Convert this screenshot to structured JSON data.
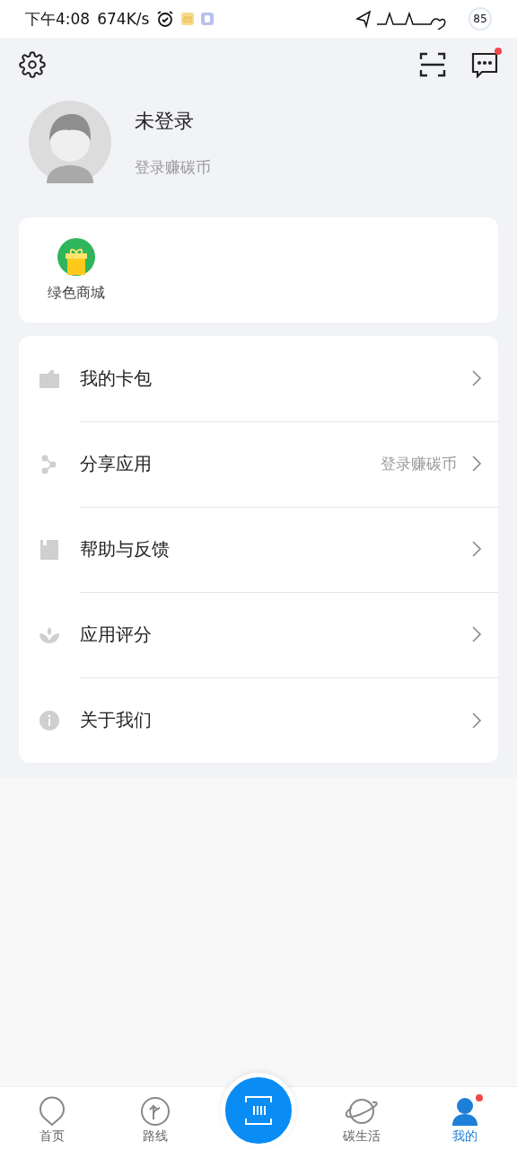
{
  "status_bar": {
    "time": "下午4:08",
    "speed": "674K/s",
    "battery": "85"
  },
  "header": {
    "message_badge": true
  },
  "profile": {
    "name": "未登录",
    "subtitle": "登录赚碳币"
  },
  "shortcuts": [
    {
      "label": "绿色商城"
    }
  ],
  "menu": [
    {
      "kind": "wallet",
      "label": "我的卡包"
    },
    {
      "kind": "share",
      "label": "分享应用",
      "note": "登录赚碳币"
    },
    {
      "kind": "book",
      "label": "帮助与反馈"
    },
    {
      "kind": "lotus",
      "label": "应用评分"
    },
    {
      "kind": "info",
      "label": "关于我们"
    }
  ],
  "tab_bar": [
    {
      "kind": "home",
      "label": "首页",
      "selected": false,
      "badge": false
    },
    {
      "kind": "route",
      "label": "路线",
      "selected": false,
      "badge": false
    },
    {
      "kind": "scan"
    },
    {
      "kind": "planet",
      "label": "碳生活",
      "selected": false,
      "badge": false
    },
    {
      "kind": "user",
      "label": "我的",
      "selected": true,
      "badge": true
    }
  ]
}
